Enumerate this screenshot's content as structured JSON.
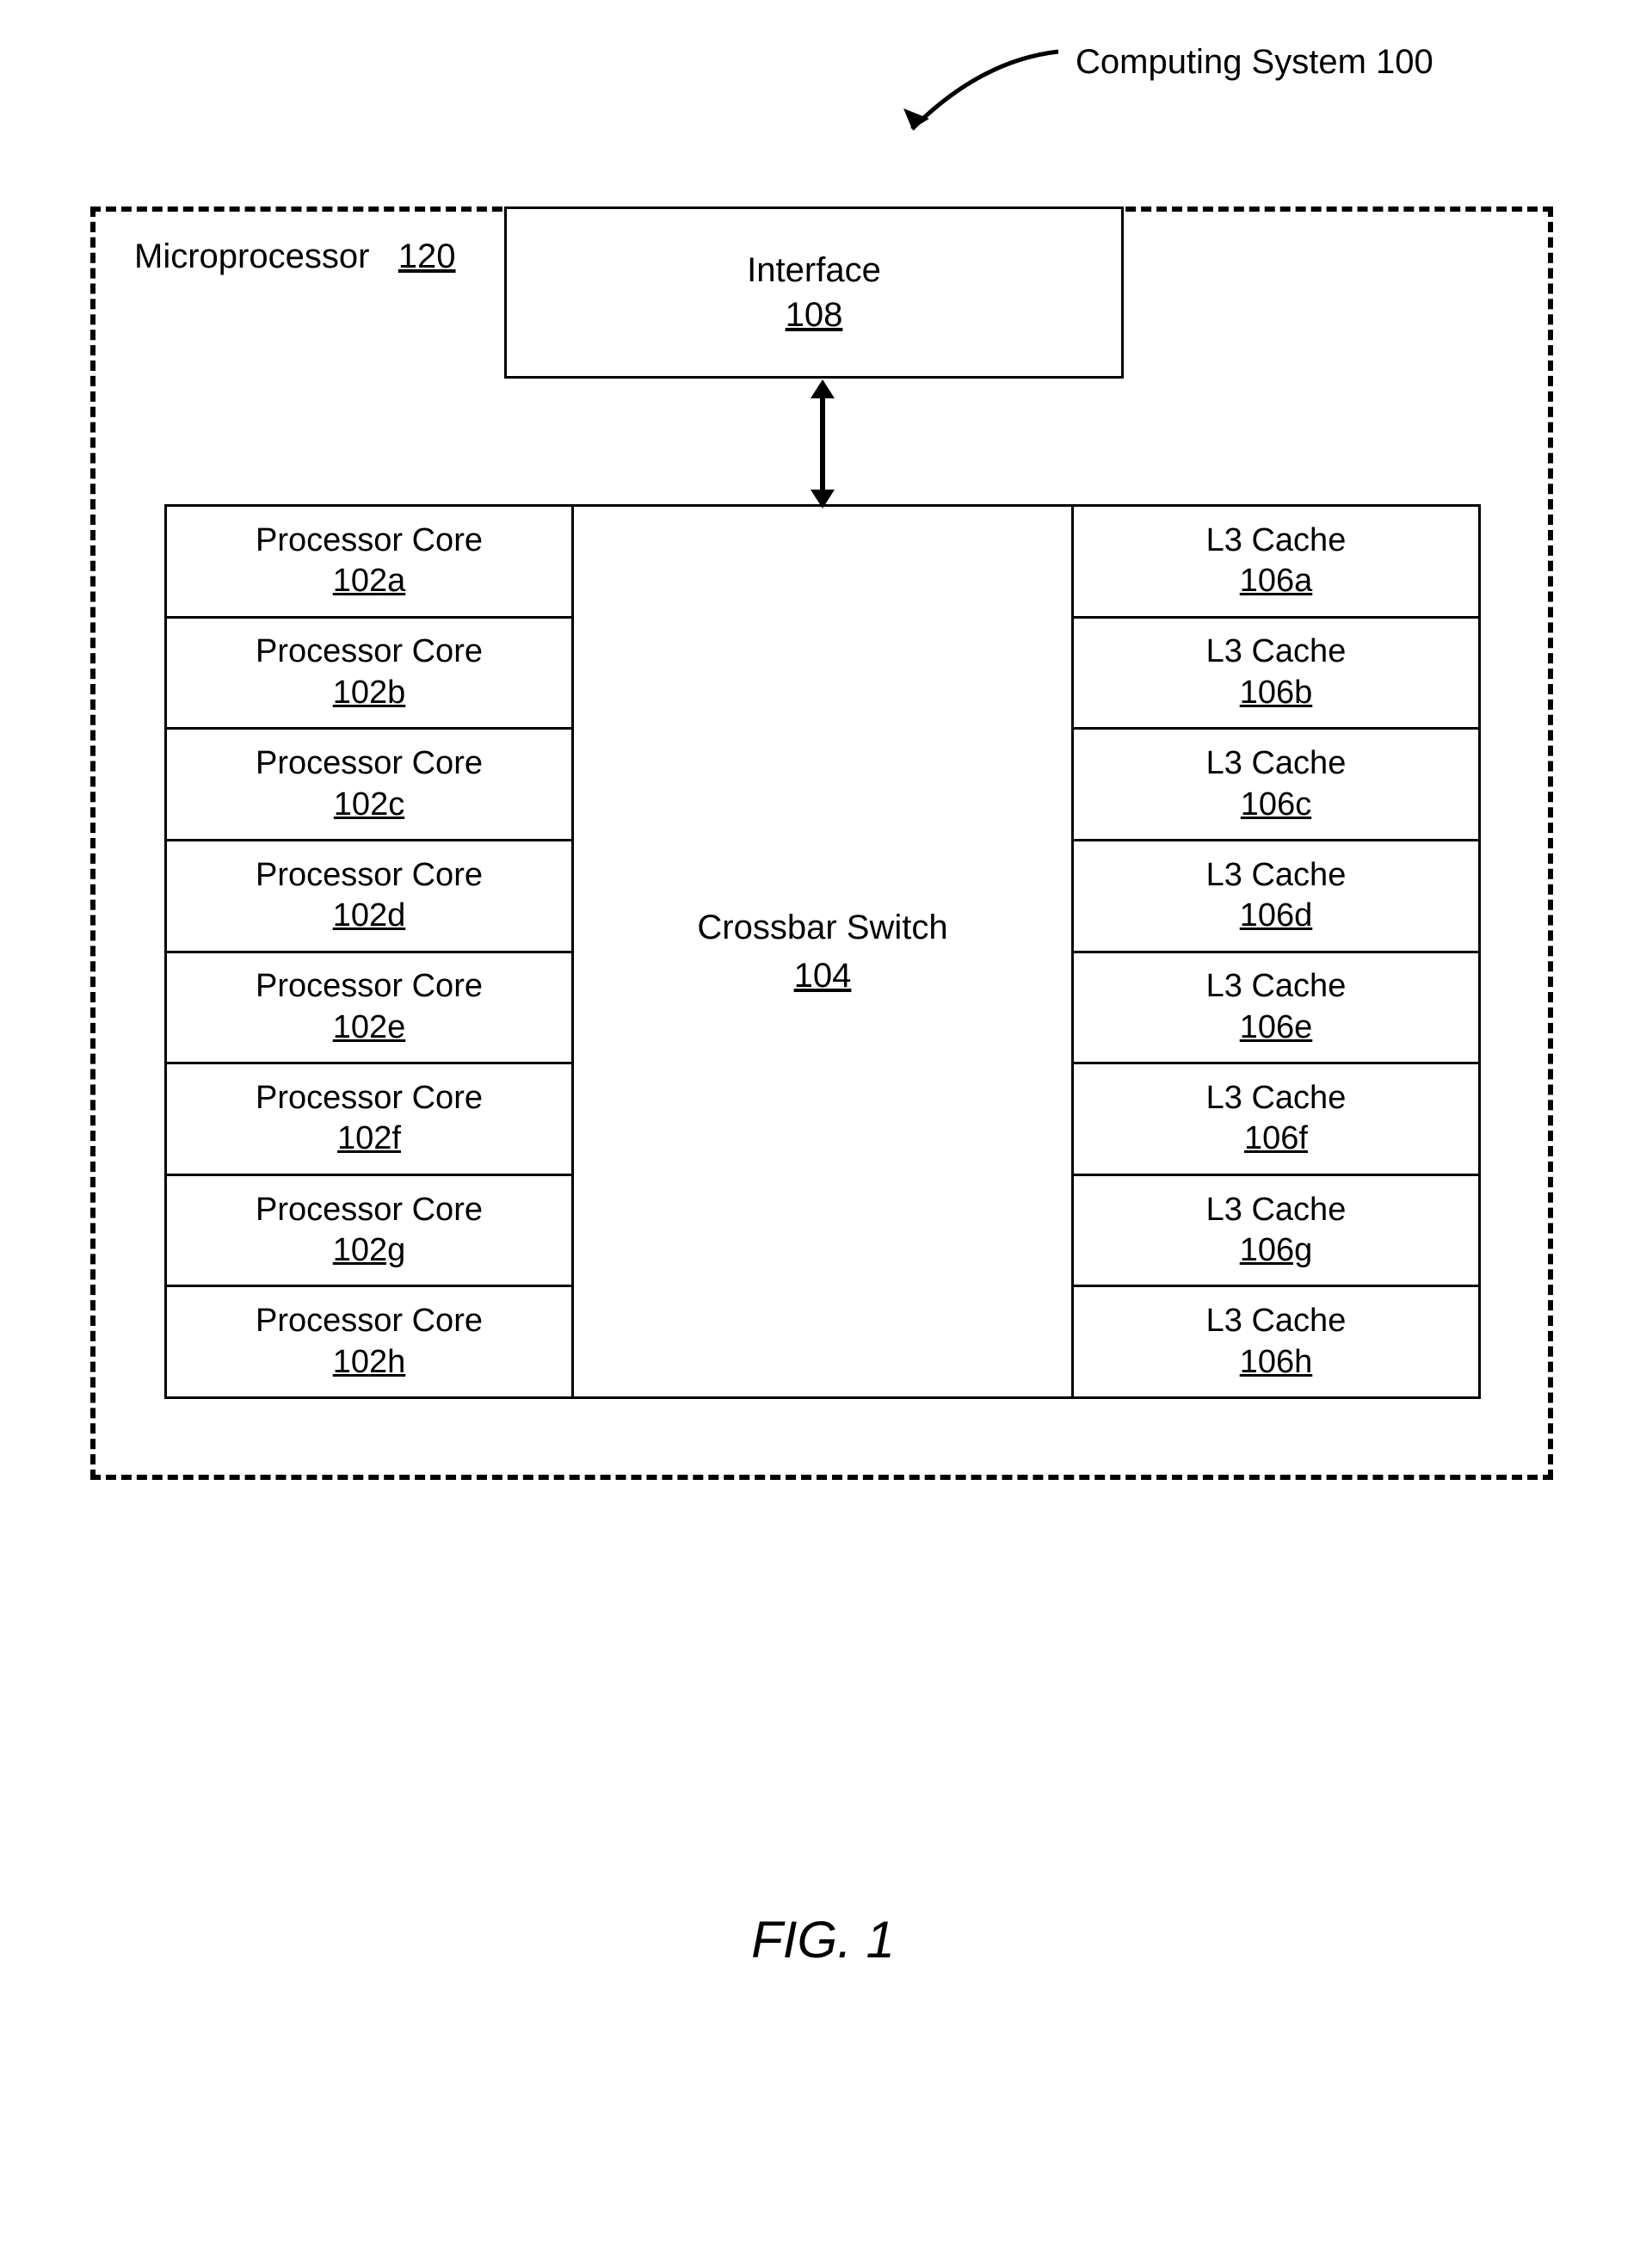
{
  "callout": {
    "label": "Computing System 100"
  },
  "microprocessor": {
    "label": "Microprocessor",
    "ref": "120"
  },
  "interface": {
    "label": "Interface",
    "ref": "108"
  },
  "crossbar": {
    "label": "Crossbar Switch",
    "ref": "104"
  },
  "cores": [
    {
      "label": "Processor Core",
      "ref": "102a"
    },
    {
      "label": "Processor Core",
      "ref": "102b"
    },
    {
      "label": "Processor Core",
      "ref": "102c"
    },
    {
      "label": "Processor Core",
      "ref": "102d"
    },
    {
      "label": "Processor Core",
      "ref": "102e"
    },
    {
      "label": "Processor Core",
      "ref": "102f"
    },
    {
      "label": "Processor Core",
      "ref": "102g"
    },
    {
      "label": "Processor Core",
      "ref": "102h"
    }
  ],
  "caches": [
    {
      "label": "L3 Cache",
      "ref": "106a"
    },
    {
      "label": "L3 Cache",
      "ref": "106b"
    },
    {
      "label": "L3 Cache",
      "ref": "106c"
    },
    {
      "label": "L3 Cache",
      "ref": "106d"
    },
    {
      "label": "L3 Cache",
      "ref": "106e"
    },
    {
      "label": "L3 Cache",
      "ref": "106f"
    },
    {
      "label": "L3 Cache",
      "ref": "106g"
    },
    {
      "label": "L3 Cache",
      "ref": "106h"
    }
  ],
  "figure_caption": "FIG. 1"
}
